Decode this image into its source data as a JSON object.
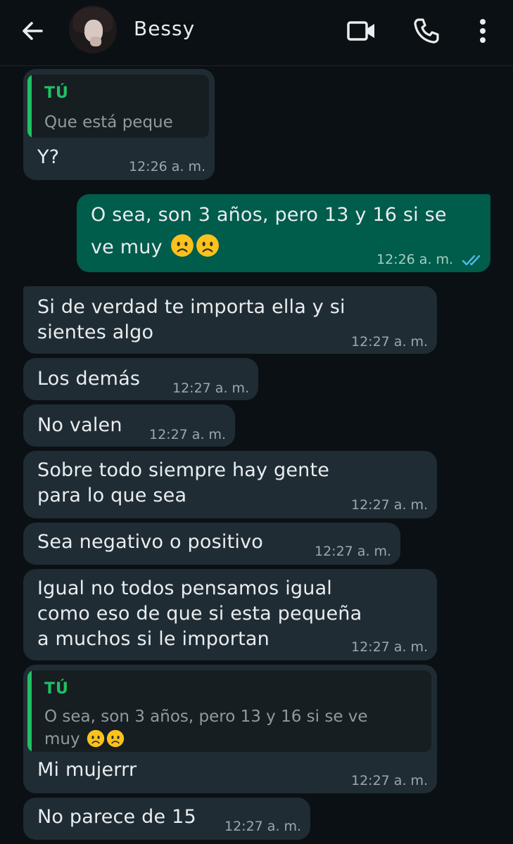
{
  "header": {
    "contact_name": "Bessy",
    "icons": [
      "arrow-back-icon",
      "video-call-icon",
      "phone-icon",
      "more-vert-icon"
    ]
  },
  "colors": {
    "background": "#0b1014",
    "incoming_bubble": "#202c33",
    "outgoing_bubble": "#005c4b",
    "quote_accent": "#21c063",
    "read_ticks": "#53bdeb"
  },
  "messages": [
    {
      "direction": "in",
      "quote": {
        "author": "TÚ",
        "text": "Que está peque"
      },
      "lines": [
        "Y?"
      ],
      "time": "12:26 a. m."
    },
    {
      "direction": "out",
      "lines": [
        "O sea, son 3 años, pero 13 y 16 si se",
        "ve muy"
      ],
      "emoji": [
        "frowning-face-emoji",
        "frowning-face-emoji"
      ],
      "time": "12:26 a. m.",
      "status": "read-double-check-icon"
    },
    {
      "direction": "in",
      "lines": [
        "Si de verdad te importa ella y si",
        "sientes algo"
      ],
      "time": "12:27 a. m."
    },
    {
      "direction": "in",
      "lines": [
        "Los demás"
      ],
      "time": "12:27 a. m."
    },
    {
      "direction": "in",
      "lines": [
        "No valen"
      ],
      "time": "12:27 a. m."
    },
    {
      "direction": "in",
      "lines": [
        "Sobre todo siempre hay gente",
        "para lo que sea"
      ],
      "time": "12:27 a. m."
    },
    {
      "direction": "in",
      "lines": [
        "Sea negativo o positivo"
      ],
      "time": "12:27 a. m."
    },
    {
      "direction": "in",
      "lines": [
        "Igual no todos pensamos igual",
        "como eso de que si esta pequeña",
        "a muchos si le importan"
      ],
      "time": "12:27 a. m."
    },
    {
      "direction": "in",
      "quote": {
        "author": "TÚ",
        "lines": [
          "O sea, son 3 años, pero 13 y 16 si se ve",
          "muy"
        ],
        "emoji": [
          "frowning-face-emoji",
          "frowning-face-emoji"
        ]
      },
      "lines": [
        "Mi mujerrr"
      ],
      "time": "12:27 a. m."
    },
    {
      "direction": "in",
      "lines": [
        "No parece de 15"
      ],
      "time": "12:27 a. m."
    }
  ]
}
